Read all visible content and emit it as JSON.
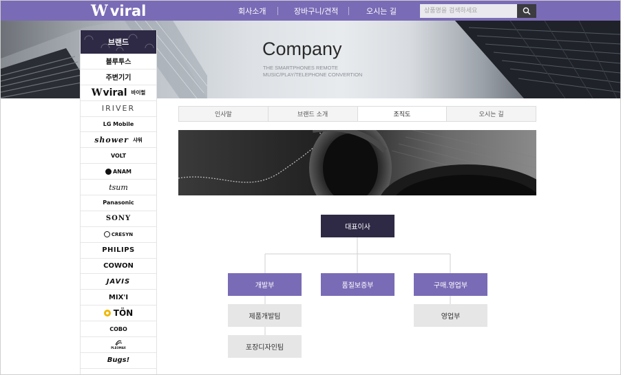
{
  "header": {
    "logo_mark": "W",
    "logo_text": "viral",
    "nav": [
      "회사소개",
      "장바구니/견적",
      "오시는 길"
    ],
    "search_placeholder": "상품명을 검색하세요"
  },
  "banner": {
    "title": "Company",
    "subtitle_line1": "THE SMARTPHONES REMOTE",
    "subtitle_line2": "MUSIC/PLAY/TELEPHONE CONVERTION"
  },
  "sidebar": {
    "heading": "브랜드",
    "items": [
      "블루투스",
      "주변기기",
      "viral",
      "IRIVER",
      "LG Mobile",
      "shower",
      "VOLT",
      "ANAM",
      "tsum",
      "Panasonic",
      "SONY",
      "CRESYN",
      "PHILIPS",
      "COWON",
      "JAVIS",
      "MIX'I",
      "TÖN",
      "COBO",
      "PLEOMAX",
      "Bugs!"
    ],
    "viral_suffix": "바이럴",
    "shower_suffix": "샤워"
  },
  "tabs": [
    "인사말",
    "브랜드 소개",
    "조직도",
    "오시는 길"
  ],
  "active_tab": 2,
  "org": {
    "ceo": "대표이사",
    "departments": [
      "개발부",
      "품질보증부",
      "구매.영업부"
    ],
    "teams_dev": [
      "제품개발팀",
      "포장디자인팀"
    ],
    "teams_sales": [
      "영업부"
    ]
  },
  "colors": {
    "brand": "#7a6bb6",
    "dark": "#2e2a45",
    "team_bg": "#e6e6e6"
  }
}
